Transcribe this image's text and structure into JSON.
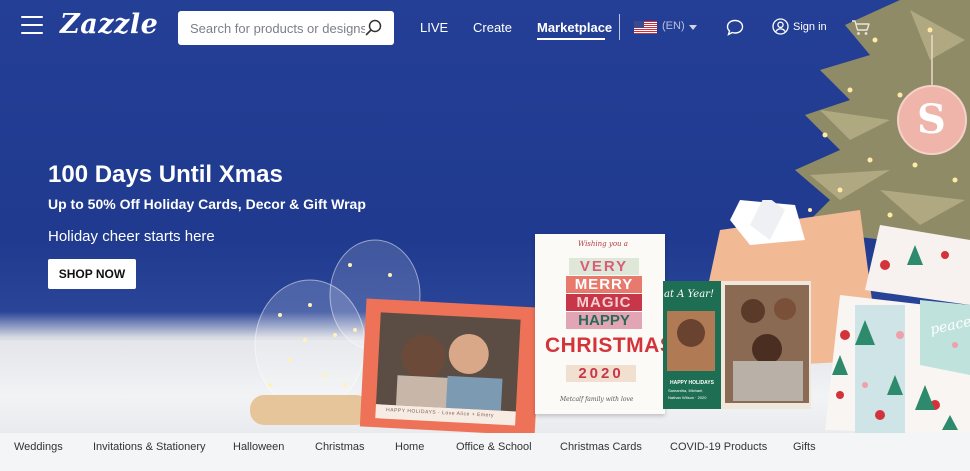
{
  "header": {
    "logo_text": "Zazzle",
    "search_placeholder": "Search for products or designs",
    "nav": {
      "live": "LIVE",
      "create": "Create",
      "marketplace": "Marketplace"
    },
    "locale_code": "(EN)",
    "sign_in": "Sign in"
  },
  "hero": {
    "headline": "100 Days Until Xmas",
    "subheadline": "Up to 50% Off Holiday Cards, Decor & Gift Wrap",
    "tagline": "Holiday cheer starts here",
    "cta": "SHOP NOW",
    "cards": {
      "christmas_card": {
        "top_script": "Wishing you a",
        "lines": [
          "VERY",
          "MERRY",
          "MAGIC",
          "HAPPY",
          "CHRISTMAS",
          "2020"
        ],
        "bottom_script": "Metcalf family with love"
      },
      "photo_card_footer": "HAPPY HOLIDAYS · Love Alice + Emery",
      "green_card": {
        "top": "at A Year!",
        "title": "HAPPY HOLIDAYS",
        "names": "Samantha, Michael,",
        "names_2": "Nathan Wilson · 2020"
      },
      "ornament_letter": "S",
      "gift_wrap_text": "peace"
    },
    "colors": {
      "background_blue": "#1f3a8f",
      "card_coral": "#ee7257",
      "card_red": "#d3343a",
      "card_green": "#1d6e52",
      "ornament_pink": "#efb5aa"
    }
  },
  "categories": [
    "Weddings",
    "Invitations & Stationery",
    "Halloween",
    "Christmas",
    "Home",
    "Office & School",
    "Christmas Cards",
    "COVID-19 Products",
    "Gifts"
  ],
  "icons": {
    "menu": "hamburger-menu-icon",
    "search": "search-icon",
    "flag": "us-flag-icon",
    "chat": "chat-bubble-icon",
    "user": "user-icon",
    "cart": "cart-icon"
  }
}
